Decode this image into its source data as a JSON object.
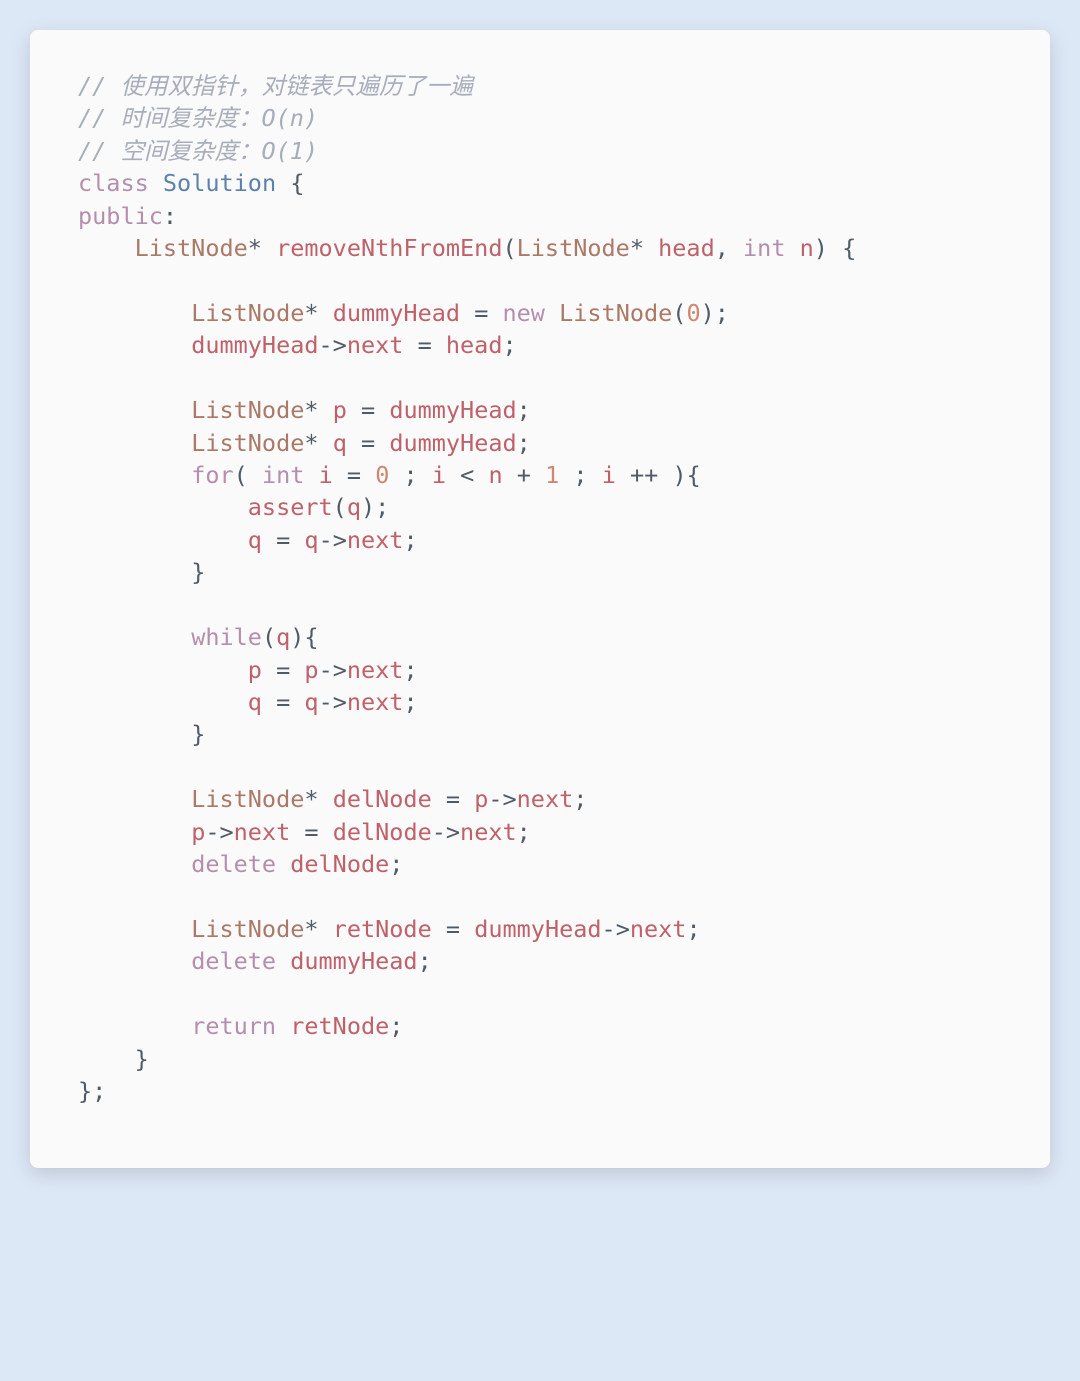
{
  "comments": {
    "c1": "// 使用双指针，对链表只遍历了一遍",
    "c2": "// 时间复杂度：O(n)",
    "c3": "// 空间复杂度：O(1)"
  },
  "kw": {
    "class": "class",
    "public": "public",
    "int": "int",
    "for": "for",
    "while": "while",
    "new": "new",
    "delete": "delete",
    "return": "return"
  },
  "types": {
    "ListNode": "ListNode"
  },
  "names": {
    "Solution": "Solution",
    "removeNthFromEnd": "removeNthFromEnd",
    "head": "head",
    "n": "n",
    "dummyHead": "dummyHead",
    "next": "next",
    "p": "p",
    "q": "q",
    "i": "i",
    "assert": "assert",
    "delNode": "delNode",
    "retNode": "retNode"
  },
  "nums": {
    "zero": "0",
    "one": "1"
  },
  "punct": {
    "star": "*",
    "lparen": "(",
    "rparen": ")",
    "lbrace": "{",
    "rbrace": "}",
    "rbraceSemi": "};",
    "comma": ",",
    "semi": ";",
    "colon": ":",
    "eq": "=",
    "lt": "<",
    "plus": "+",
    "pp": "++",
    "arrow": "->"
  }
}
